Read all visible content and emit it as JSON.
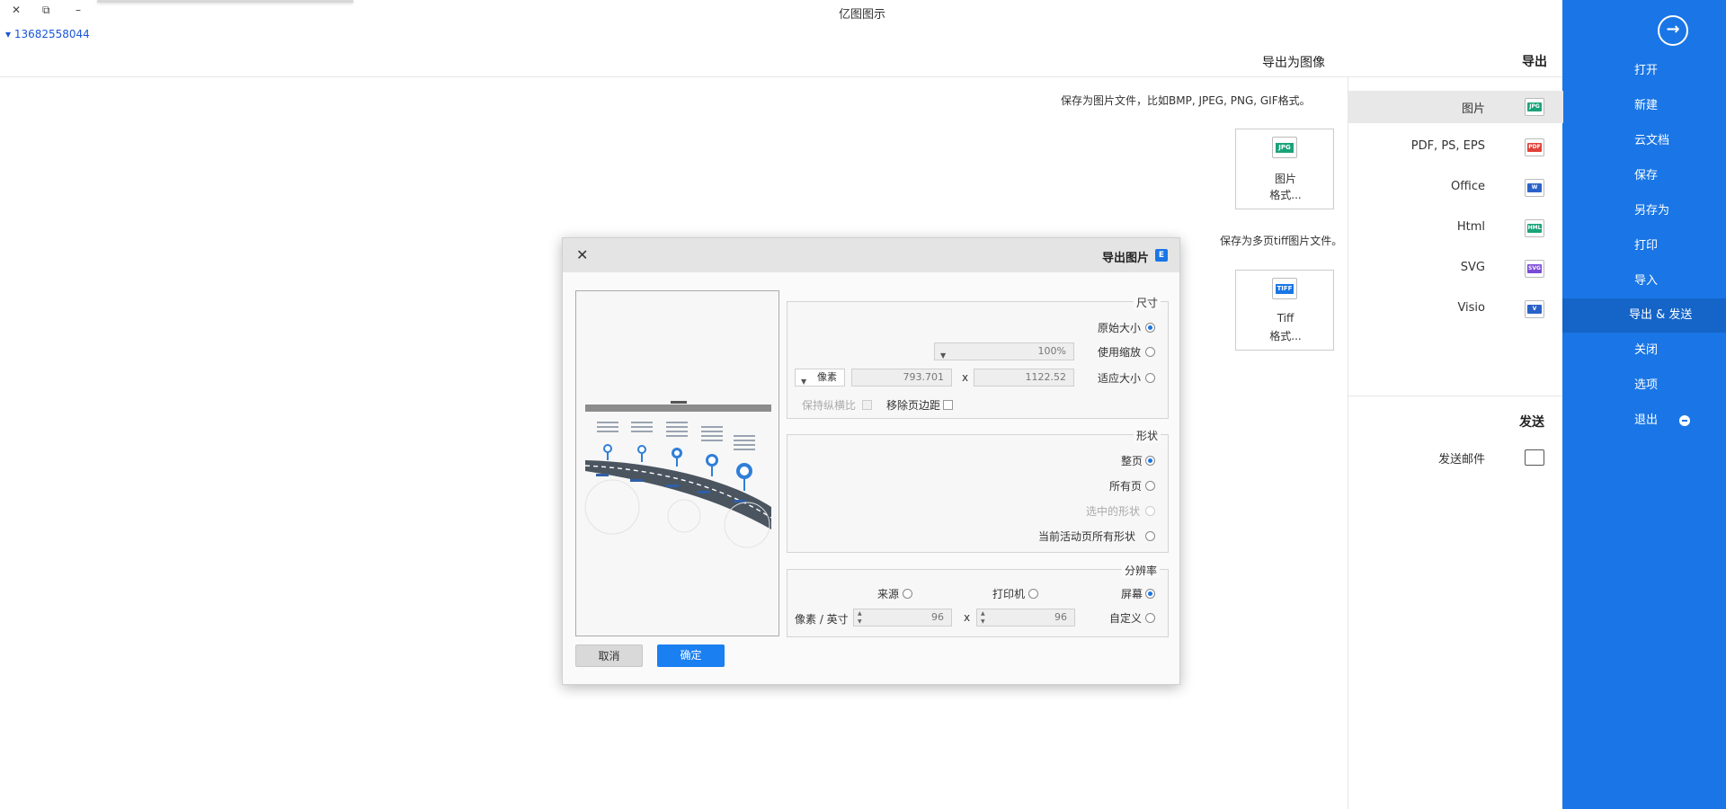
{
  "window": {
    "title": "亿图图示",
    "account": "▾ 13682558044",
    "controls": {
      "close": "✕",
      "restore": "⧉",
      "minimize": "–"
    }
  },
  "header": {
    "section_title": "导出为图像"
  },
  "sidebar": {
    "back_icon": "arrow-right-circle-icon",
    "items": [
      {
        "label": "打开"
      },
      {
        "label": "新建"
      },
      {
        "label": "云文档"
      },
      {
        "label": "保存"
      },
      {
        "label": "另存为"
      },
      {
        "label": "打印"
      },
      {
        "label": "导入"
      },
      {
        "label": "导出 & 发送",
        "active": true
      },
      {
        "label": "关闭"
      },
      {
        "label": "选项"
      },
      {
        "label": "退出"
      }
    ]
  },
  "export_panel": {
    "heading": "导出",
    "items": [
      {
        "label": "图片",
        "badge": "JPG",
        "color": "#1aa37a",
        "active": true
      },
      {
        "label": "PDF, PS, EPS",
        "badge": "PDF",
        "color": "#e0413a"
      },
      {
        "label": "Office",
        "badge": "W",
        "color": "#2b62c9"
      },
      {
        "label": "Html",
        "badge": "HML",
        "color": "#1aa37a"
      },
      {
        "label": "SVG",
        "badge": "SVG",
        "color": "#7a4bd6"
      },
      {
        "label": "Visio",
        "badge": "V",
        "color": "#2b62c9"
      }
    ],
    "send_heading": "发送",
    "send_items": [
      {
        "label": "发送邮件"
      }
    ]
  },
  "main": {
    "image_desc": "保存为图片文件，比如BMP, JPEG, PNG, GIF格式。",
    "image_card": {
      "badge": "JPG",
      "line1": "图片",
      "line2": "格式..."
    },
    "tiff_desc": "保存为多页tiff图片文件。",
    "tiff_card": {
      "badge": "TIFF",
      "line1": "Tiff",
      "line2": "格式..."
    }
  },
  "dialog": {
    "title": "导出图片",
    "logo": "E",
    "close": "✕",
    "size": {
      "label": "尺寸",
      "original": "原始大小",
      "zoom": "使用缩放",
      "zoom_value": "100%",
      "fit": "适应大小",
      "width": "1122.52",
      "height": "793.701",
      "x": "x",
      "unit": "像素",
      "remove_margin": "移除页边距",
      "keep_ratio": "保持纵横比"
    },
    "shape": {
      "label": "形状",
      "whole_page": "整页",
      "all_pages": "所有页",
      "selected": "选中的形状",
      "current_page_all": "当前活动页所有形状"
    },
    "resolution": {
      "label": "分辨率",
      "screen": "屏幕",
      "printer": "打印机",
      "source": "来源",
      "custom": "自定义",
      "dpi_x": "96",
      "dpi_y": "96",
      "x": "x",
      "unit": "像素 / 英寸"
    },
    "ok": "确定",
    "cancel": "取消"
  }
}
